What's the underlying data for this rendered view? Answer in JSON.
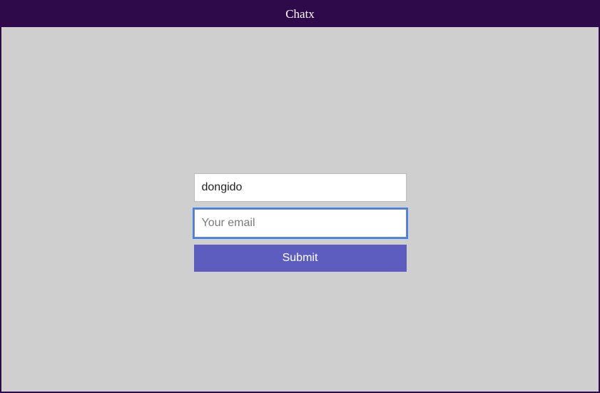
{
  "header": {
    "title": "Chatx"
  },
  "form": {
    "name_value": "dongido",
    "name_placeholder": "",
    "email_value": "",
    "email_placeholder": "Your email",
    "submit_label": "Submit"
  }
}
